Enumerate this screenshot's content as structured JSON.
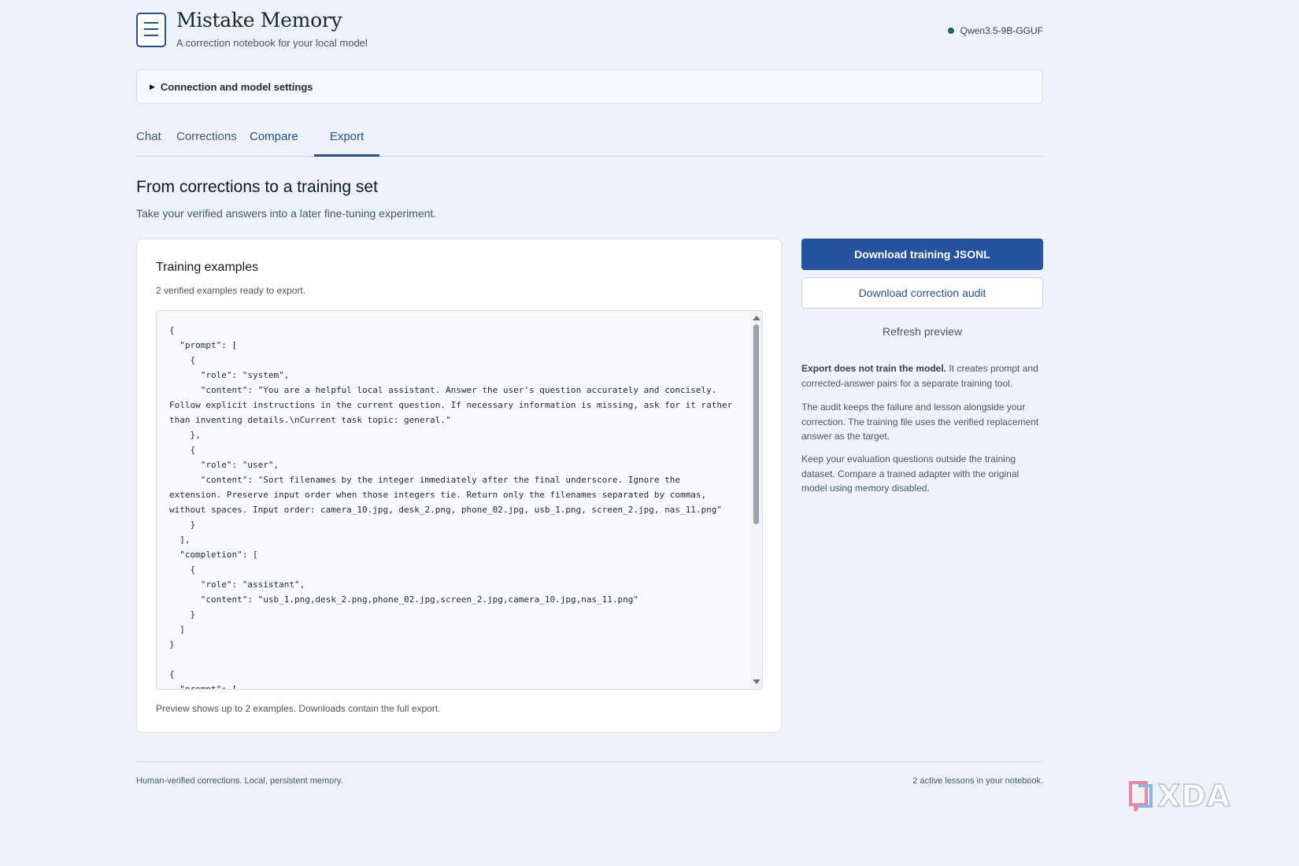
{
  "app": {
    "title": "Mistake Memory",
    "subtitle": "A correction notebook for your local model",
    "model": "Qwen3.5-9B-GGUF",
    "status_color": "#1e6b4a",
    "accent": "#25539f"
  },
  "settings": {
    "label": "Connection and model settings"
  },
  "tabs": [
    {
      "label": "Chat"
    },
    {
      "label": "Corrections"
    },
    {
      "label": "Compare"
    },
    {
      "label": "Export",
      "active": true
    }
  ],
  "section": {
    "title": "From corrections to a training set",
    "subtitle": "Take your verified answers into a later fine-tuning experiment."
  },
  "card": {
    "title": "Training examples",
    "count": "2 verified examples ready to export.",
    "code": "{\n  \"prompt\": [\n    {\n      \"role\": \"system\",\n      \"content\": \"You are a helpful local assistant. Answer the user's question accurately and concisely. Follow explicit instructions in the current question. If necessary information is missing, ask for it rather than inventing details.\\nCurrent task topic: general.\"\n    },\n    {\n      \"role\": \"user\",\n      \"content\": \"Sort filenames by the integer immediately after the final underscore. Ignore the extension. Preserve input order when those integers tie. Return only the filenames separated by commas, without spaces. Input order: camera_10.jpg, desk_2.png, phone_02.jpg, usb_1.png, screen_2.jpg, nas_11.png\"\n    }\n  ],\n  \"completion\": [\n    {\n      \"role\": \"assistant\",\n      \"content\": \"usb_1.png,desk_2.png,phone_02.jpg,screen_2.jpg,camera_10.jpg,nas_11.png\"\n    }\n  ]\n}\n\n{\n  \"prompt\": [",
    "note": "Preview shows up to 2 examples. Downloads contain the full export."
  },
  "actions": {
    "primary": "Download training JSONL",
    "secondary": "Download correction audit",
    "refresh": "Refresh preview"
  },
  "info": {
    "p1_bold": "Export does not train the model.",
    "p1_rest": " It creates prompt and corrected-answer pairs for a separate training tool.",
    "p2": "The audit keeps the failure and lesson alongside your correction. The training file uses the verified replacement answer as the target.",
    "p3": "Keep your evaluation questions outside the training dataset. Compare a trained adapter with the original model using memory disabled."
  },
  "footer": {
    "left": "Human-verified corrections. Local, persistent memory.",
    "right": "2 active lessons in your notebook."
  },
  "watermark": {
    "text": "XDA"
  }
}
